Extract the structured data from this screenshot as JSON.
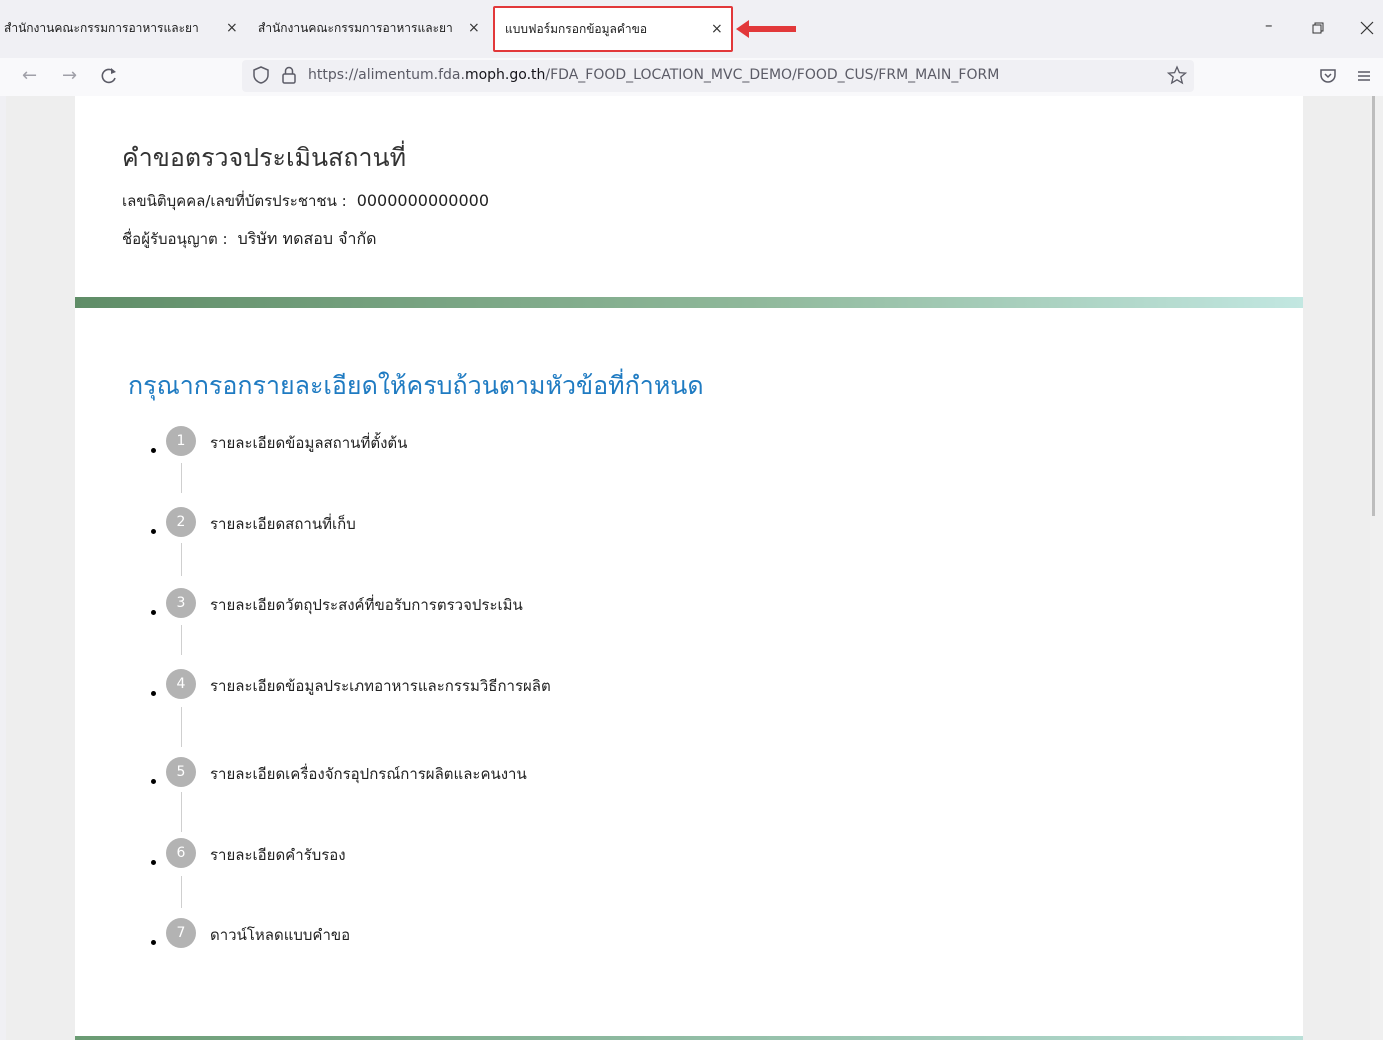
{
  "browser": {
    "tabs": [
      {
        "label": "สำนักงานคณะกรรมการอาหารและยา"
      },
      {
        "label": "สำนักงานคณะกรรมการอาหารและยา"
      },
      {
        "label": "แบบฟอร์มกรอกข้อมูลคำขอ",
        "active": true
      }
    ],
    "tab_close_glyph": "×",
    "url_prefix": "https://alimentum.fda.",
    "url_host": "moph.go.th",
    "url_path": "/FDA_FOOD_LOCATION_MVC_DEMO/FOOD_CUS/FRM_MAIN_FORM",
    "highlight_color": "#e2383a"
  },
  "header": {
    "title": "คำขอตรวจประเมินสถานที่",
    "id_label": "เลขนิติบุคคล/เลขที่บัตรประชาชน :",
    "id_value": "0000000000000",
    "licensee_label": "ชื่อผู้รับอนุญาต :",
    "licensee_value": "บริษัท ทดสอบ จำกัด"
  },
  "main": {
    "section_title": "กรุณากรอกรายละเอียดให้ครบถ้วนตามหัวข้อที่กำหนด",
    "accent_color": "#1f7bc2",
    "steps": [
      {
        "number": "1",
        "label": "รายละเอียดข้อมูลสถานที่ตั้งต้น"
      },
      {
        "number": "2",
        "label": "รายละเอียดสถานที่เก็บ"
      },
      {
        "number": "3",
        "label": "รายละเอียดวัตถุประสงค์ที่ขอรับการตรวจประเมิน"
      },
      {
        "number": "4",
        "label": "รายละเอียดข้อมูลประเภทอาหารและกรรมวิธีการผลิต"
      },
      {
        "number": "5",
        "label": "รายละเอียดเครื่องจักรอุปกรณ์การผลิตและคนงาน"
      },
      {
        "number": "6",
        "label": "รายละเอียดคำรับรอง"
      },
      {
        "number": "7",
        "label": "ดาวน์โหลดแบบคำขอ"
      }
    ]
  }
}
